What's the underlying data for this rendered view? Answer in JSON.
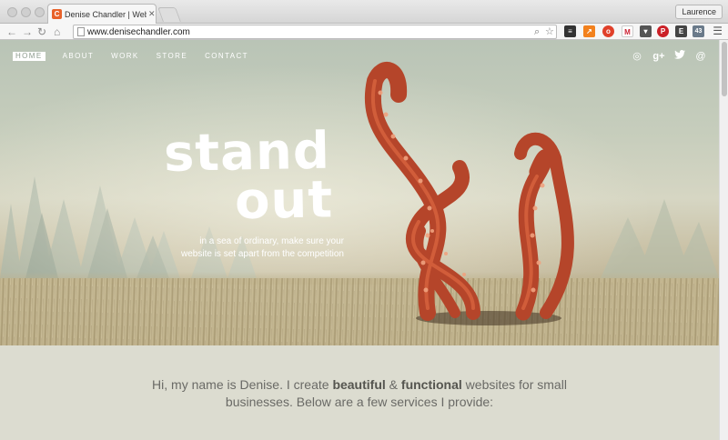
{
  "browser": {
    "tab_title": "Denise Chandler | Web Desi",
    "tab_favicon": "C",
    "profile_name": "Laurence",
    "url": "www.denisechandler.com",
    "extension_badge": "43"
  },
  "site": {
    "nav": [
      {
        "label": "HOME"
      },
      {
        "label": "ABOUT"
      },
      {
        "label": "WORK"
      },
      {
        "label": "STORE"
      },
      {
        "label": "CONTACT"
      }
    ],
    "social_icons": [
      "dribbble-icon",
      "google-plus-icon",
      "twitter-icon",
      "at-icon"
    ],
    "headline_line1": "stand",
    "headline_line2": "out",
    "tagline_line1": "in a sea of ordinary, make sure your",
    "tagline_line2": "website is set apart from the competition",
    "intro_part1": "Hi, my name is Denise. I create ",
    "intro_bold1": "beautiful",
    "intro_amp": " & ",
    "intro_bold2": "functional",
    "intro_part2": " websites for small businesses. Below are a few services I provide:"
  },
  "colors": {
    "hero_sky": "#c6cdbc",
    "tentacle": "#b5452a",
    "intro_bg": "#dcdcd0",
    "text": "#6a6a66"
  }
}
